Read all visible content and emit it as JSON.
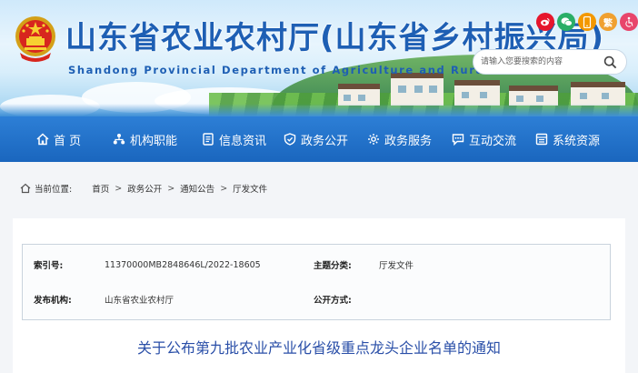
{
  "header": {
    "title_cn": "山东省农业农村厅(山东省乡村振兴局)",
    "title_en": "Shandong Provincial Department of Agriculture and Rural Affairs",
    "tools": [
      {
        "icon": "weibo-icon",
        "color": "#e6162d",
        "label": ""
      },
      {
        "icon": "wechat-icon",
        "color": "#2aae67",
        "label": ""
      },
      {
        "icon": "mobile-icon",
        "color": "#f39800",
        "label": ""
      },
      {
        "icon": "traditional-chinese-icon",
        "color": "#f0a030",
        "label": "繁"
      },
      {
        "icon": "accessibility-icon",
        "color": "#e8456b",
        "label": ""
      }
    ],
    "search": {
      "placeholder": "请输入您要搜索的内容"
    }
  },
  "nav": {
    "items": [
      {
        "label": "首 页",
        "icon": "home-icon"
      },
      {
        "label": "机构职能",
        "icon": "org-icon"
      },
      {
        "label": "信息资讯",
        "icon": "news-icon"
      },
      {
        "label": "政务公开",
        "icon": "open-gov-icon"
      },
      {
        "label": "政务服务",
        "icon": "service-icon"
      },
      {
        "label": "互动交流",
        "icon": "chat-icon"
      },
      {
        "label": "系统资源",
        "icon": "resource-icon"
      }
    ]
  },
  "breadcrumb": {
    "prefix": "当前位置:",
    "items": [
      "首页",
      "政务公开",
      "通知公告",
      "厅发文件"
    ]
  },
  "meta": {
    "index_label": "索引号:",
    "index_value": "11370000MB2848646L/2022-18605",
    "category_label": "主题分类:",
    "category_value": "厅发文件",
    "issuer_label": "发布机构:",
    "issuer_value": "山东省农业农村厅",
    "method_label": "公开方式:",
    "method_value": ""
  },
  "document": {
    "title": "关于公布第九批农业产业化省级重点龙头企业名单的通知"
  },
  "colors": {
    "brand": "#1e5fb4",
    "nav": "#1a66be",
    "doc_title": "#2a4fa8"
  }
}
